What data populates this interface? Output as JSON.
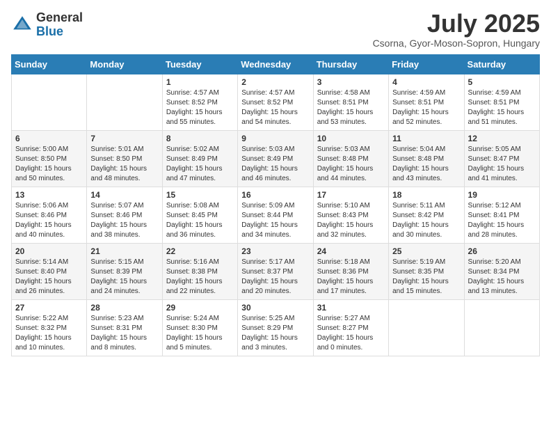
{
  "header": {
    "logo_general": "General",
    "logo_blue": "Blue",
    "month_title": "July 2025",
    "location": "Csorna, Gyor-Moson-Sopron, Hungary"
  },
  "weekdays": [
    "Sunday",
    "Monday",
    "Tuesday",
    "Wednesday",
    "Thursday",
    "Friday",
    "Saturday"
  ],
  "weeks": [
    [
      {
        "day": "",
        "sunrise": "",
        "sunset": "",
        "daylight": ""
      },
      {
        "day": "",
        "sunrise": "",
        "sunset": "",
        "daylight": ""
      },
      {
        "day": "1",
        "sunrise": "Sunrise: 4:57 AM",
        "sunset": "Sunset: 8:52 PM",
        "daylight": "Daylight: 15 hours and 55 minutes."
      },
      {
        "day": "2",
        "sunrise": "Sunrise: 4:57 AM",
        "sunset": "Sunset: 8:52 PM",
        "daylight": "Daylight: 15 hours and 54 minutes."
      },
      {
        "day": "3",
        "sunrise": "Sunrise: 4:58 AM",
        "sunset": "Sunset: 8:51 PM",
        "daylight": "Daylight: 15 hours and 53 minutes."
      },
      {
        "day": "4",
        "sunrise": "Sunrise: 4:59 AM",
        "sunset": "Sunset: 8:51 PM",
        "daylight": "Daylight: 15 hours and 52 minutes."
      },
      {
        "day": "5",
        "sunrise": "Sunrise: 4:59 AM",
        "sunset": "Sunset: 8:51 PM",
        "daylight": "Daylight: 15 hours and 51 minutes."
      }
    ],
    [
      {
        "day": "6",
        "sunrise": "Sunrise: 5:00 AM",
        "sunset": "Sunset: 8:50 PM",
        "daylight": "Daylight: 15 hours and 50 minutes."
      },
      {
        "day": "7",
        "sunrise": "Sunrise: 5:01 AM",
        "sunset": "Sunset: 8:50 PM",
        "daylight": "Daylight: 15 hours and 48 minutes."
      },
      {
        "day": "8",
        "sunrise": "Sunrise: 5:02 AM",
        "sunset": "Sunset: 8:49 PM",
        "daylight": "Daylight: 15 hours and 47 minutes."
      },
      {
        "day": "9",
        "sunrise": "Sunrise: 5:03 AM",
        "sunset": "Sunset: 8:49 PM",
        "daylight": "Daylight: 15 hours and 46 minutes."
      },
      {
        "day": "10",
        "sunrise": "Sunrise: 5:03 AM",
        "sunset": "Sunset: 8:48 PM",
        "daylight": "Daylight: 15 hours and 44 minutes."
      },
      {
        "day": "11",
        "sunrise": "Sunrise: 5:04 AM",
        "sunset": "Sunset: 8:48 PM",
        "daylight": "Daylight: 15 hours and 43 minutes."
      },
      {
        "day": "12",
        "sunrise": "Sunrise: 5:05 AM",
        "sunset": "Sunset: 8:47 PM",
        "daylight": "Daylight: 15 hours and 41 minutes."
      }
    ],
    [
      {
        "day": "13",
        "sunrise": "Sunrise: 5:06 AM",
        "sunset": "Sunset: 8:46 PM",
        "daylight": "Daylight: 15 hours and 40 minutes."
      },
      {
        "day": "14",
        "sunrise": "Sunrise: 5:07 AM",
        "sunset": "Sunset: 8:46 PM",
        "daylight": "Daylight: 15 hours and 38 minutes."
      },
      {
        "day": "15",
        "sunrise": "Sunrise: 5:08 AM",
        "sunset": "Sunset: 8:45 PM",
        "daylight": "Daylight: 15 hours and 36 minutes."
      },
      {
        "day": "16",
        "sunrise": "Sunrise: 5:09 AM",
        "sunset": "Sunset: 8:44 PM",
        "daylight": "Daylight: 15 hours and 34 minutes."
      },
      {
        "day": "17",
        "sunrise": "Sunrise: 5:10 AM",
        "sunset": "Sunset: 8:43 PM",
        "daylight": "Daylight: 15 hours and 32 minutes."
      },
      {
        "day": "18",
        "sunrise": "Sunrise: 5:11 AM",
        "sunset": "Sunset: 8:42 PM",
        "daylight": "Daylight: 15 hours and 30 minutes."
      },
      {
        "day": "19",
        "sunrise": "Sunrise: 5:12 AM",
        "sunset": "Sunset: 8:41 PM",
        "daylight": "Daylight: 15 hours and 28 minutes."
      }
    ],
    [
      {
        "day": "20",
        "sunrise": "Sunrise: 5:14 AM",
        "sunset": "Sunset: 8:40 PM",
        "daylight": "Daylight: 15 hours and 26 minutes."
      },
      {
        "day": "21",
        "sunrise": "Sunrise: 5:15 AM",
        "sunset": "Sunset: 8:39 PM",
        "daylight": "Daylight: 15 hours and 24 minutes."
      },
      {
        "day": "22",
        "sunrise": "Sunrise: 5:16 AM",
        "sunset": "Sunset: 8:38 PM",
        "daylight": "Daylight: 15 hours and 22 minutes."
      },
      {
        "day": "23",
        "sunrise": "Sunrise: 5:17 AM",
        "sunset": "Sunset: 8:37 PM",
        "daylight": "Daylight: 15 hours and 20 minutes."
      },
      {
        "day": "24",
        "sunrise": "Sunrise: 5:18 AM",
        "sunset": "Sunset: 8:36 PM",
        "daylight": "Daylight: 15 hours and 17 minutes."
      },
      {
        "day": "25",
        "sunrise": "Sunrise: 5:19 AM",
        "sunset": "Sunset: 8:35 PM",
        "daylight": "Daylight: 15 hours and 15 minutes."
      },
      {
        "day": "26",
        "sunrise": "Sunrise: 5:20 AM",
        "sunset": "Sunset: 8:34 PM",
        "daylight": "Daylight: 15 hours and 13 minutes."
      }
    ],
    [
      {
        "day": "27",
        "sunrise": "Sunrise: 5:22 AM",
        "sunset": "Sunset: 8:32 PM",
        "daylight": "Daylight: 15 hours and 10 minutes."
      },
      {
        "day": "28",
        "sunrise": "Sunrise: 5:23 AM",
        "sunset": "Sunset: 8:31 PM",
        "daylight": "Daylight: 15 hours and 8 minutes."
      },
      {
        "day": "29",
        "sunrise": "Sunrise: 5:24 AM",
        "sunset": "Sunset: 8:30 PM",
        "daylight": "Daylight: 15 hours and 5 minutes."
      },
      {
        "day": "30",
        "sunrise": "Sunrise: 5:25 AM",
        "sunset": "Sunset: 8:29 PM",
        "daylight": "Daylight: 15 hours and 3 minutes."
      },
      {
        "day": "31",
        "sunrise": "Sunrise: 5:27 AM",
        "sunset": "Sunset: 8:27 PM",
        "daylight": "Daylight: 15 hours and 0 minutes."
      },
      {
        "day": "",
        "sunrise": "",
        "sunset": "",
        "daylight": ""
      },
      {
        "day": "",
        "sunrise": "",
        "sunset": "",
        "daylight": ""
      }
    ]
  ]
}
